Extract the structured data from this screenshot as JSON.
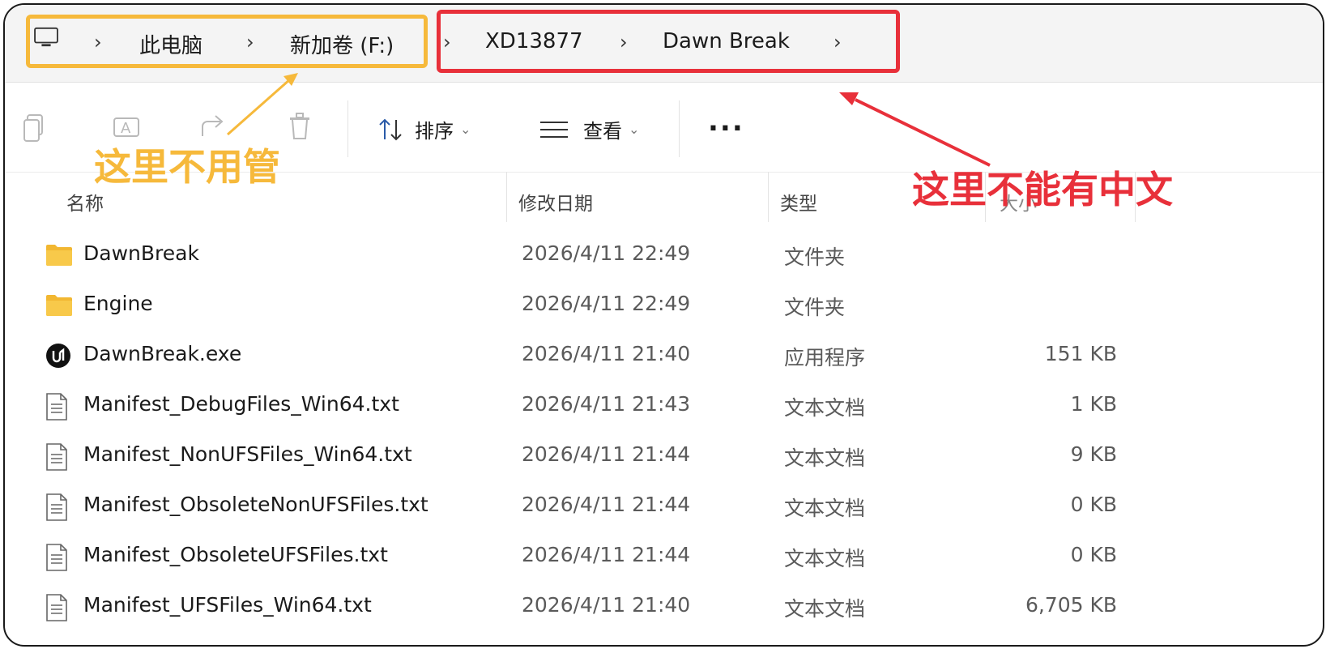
{
  "address_bar": {
    "crumbs": [
      "此电脑",
      "新加卷 (F:)",
      "XD13877",
      "Dawn Break"
    ]
  },
  "toolbar": {
    "sort_label": "排序",
    "view_label": "查看",
    "more_label": "..."
  },
  "columns": {
    "name": "名称",
    "date": "修改日期",
    "type": "类型",
    "size": "大小"
  },
  "files": [
    {
      "name": "DawnBreak",
      "date": "2026/4/11 22:49",
      "type": "文件夹",
      "size": "",
      "icon": "folder-icon"
    },
    {
      "name": "Engine",
      "date": "2026/4/11 22:49",
      "type": "文件夹",
      "size": "",
      "icon": "folder-icon"
    },
    {
      "name": "DawnBreak.exe",
      "date": "2026/4/11 21:40",
      "type": "应用程序",
      "size": "151 KB",
      "icon": "unreal-app-icon"
    },
    {
      "name": "Manifest_DebugFiles_Win64.txt",
      "date": "2026/4/11 21:43",
      "type": "文本文档",
      "size": "1 KB",
      "icon": "text-file-icon"
    },
    {
      "name": "Manifest_NonUFSFiles_Win64.txt",
      "date": "2026/4/11 21:44",
      "type": "文本文档",
      "size": "9 KB",
      "icon": "text-file-icon"
    },
    {
      "name": "Manifest_ObsoleteNonUFSFiles.txt",
      "date": "2026/4/11 21:44",
      "type": "文本文档",
      "size": "0 KB",
      "icon": "text-file-icon"
    },
    {
      "name": "Manifest_ObsoleteUFSFiles.txt",
      "date": "2026/4/11 21:44",
      "type": "文本文档",
      "size": "0 KB",
      "icon": "text-file-icon"
    },
    {
      "name": "Manifest_UFSFiles_Win64.txt",
      "date": "2026/4/11 21:40",
      "type": "文本文档",
      "size": "6,705 KB",
      "icon": "text-file-icon"
    }
  ],
  "annotations": {
    "yellow_text": "这里不用管",
    "red_text": "这里不能有中文",
    "yellow_color": "#f6b93b",
    "red_color": "#e8303a"
  }
}
